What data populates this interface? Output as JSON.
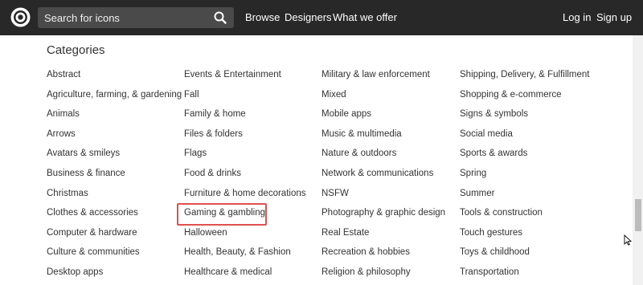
{
  "header": {
    "search_placeholder": "Search for icons",
    "nav": {
      "browse": "Browse",
      "designers": "Designers",
      "what_we_offer": "What we offer",
      "login": "Log in",
      "signup": "Sign up"
    }
  },
  "main": {
    "title": "Categories",
    "columns": [
      [
        "Abstract",
        "Agriculture, farming, & gardening",
        "Animals",
        "Arrows",
        "Avatars & smileys",
        "Business & finance",
        "Christmas",
        "Clothes & accessories",
        "Computer & hardware",
        "Culture & communities",
        "Desktop apps"
      ],
      [
        "Events & Entertainment",
        "Fall",
        "Family & home",
        "Files & folders",
        "Flags",
        "Food & drinks",
        "Furniture & home decorations",
        "Gaming & gambling",
        "Halloween",
        "Health, Beauty, & Fashion",
        "Healthcare & medical"
      ],
      [
        "Military & law enforcement",
        "Mixed",
        "Mobile apps",
        "Music & multimedia",
        "Nature & outdoors",
        "Network & communications",
        "NSFW",
        "Photography & graphic design",
        "Real Estate",
        "Recreation & hobbies",
        "Religion & philosophy"
      ],
      [
        "Shipping, Delivery, & Fulfillment",
        "Shopping & e-commerce",
        "Signs & symbols",
        "Social media",
        "Sports & awards",
        "Spring",
        "Summer",
        "Tools & construction",
        "Touch gestures",
        "Toys & childhood",
        "Transportation"
      ]
    ]
  },
  "colors": {
    "header_bg": "#282828",
    "highlight_border": "#e05050"
  }
}
